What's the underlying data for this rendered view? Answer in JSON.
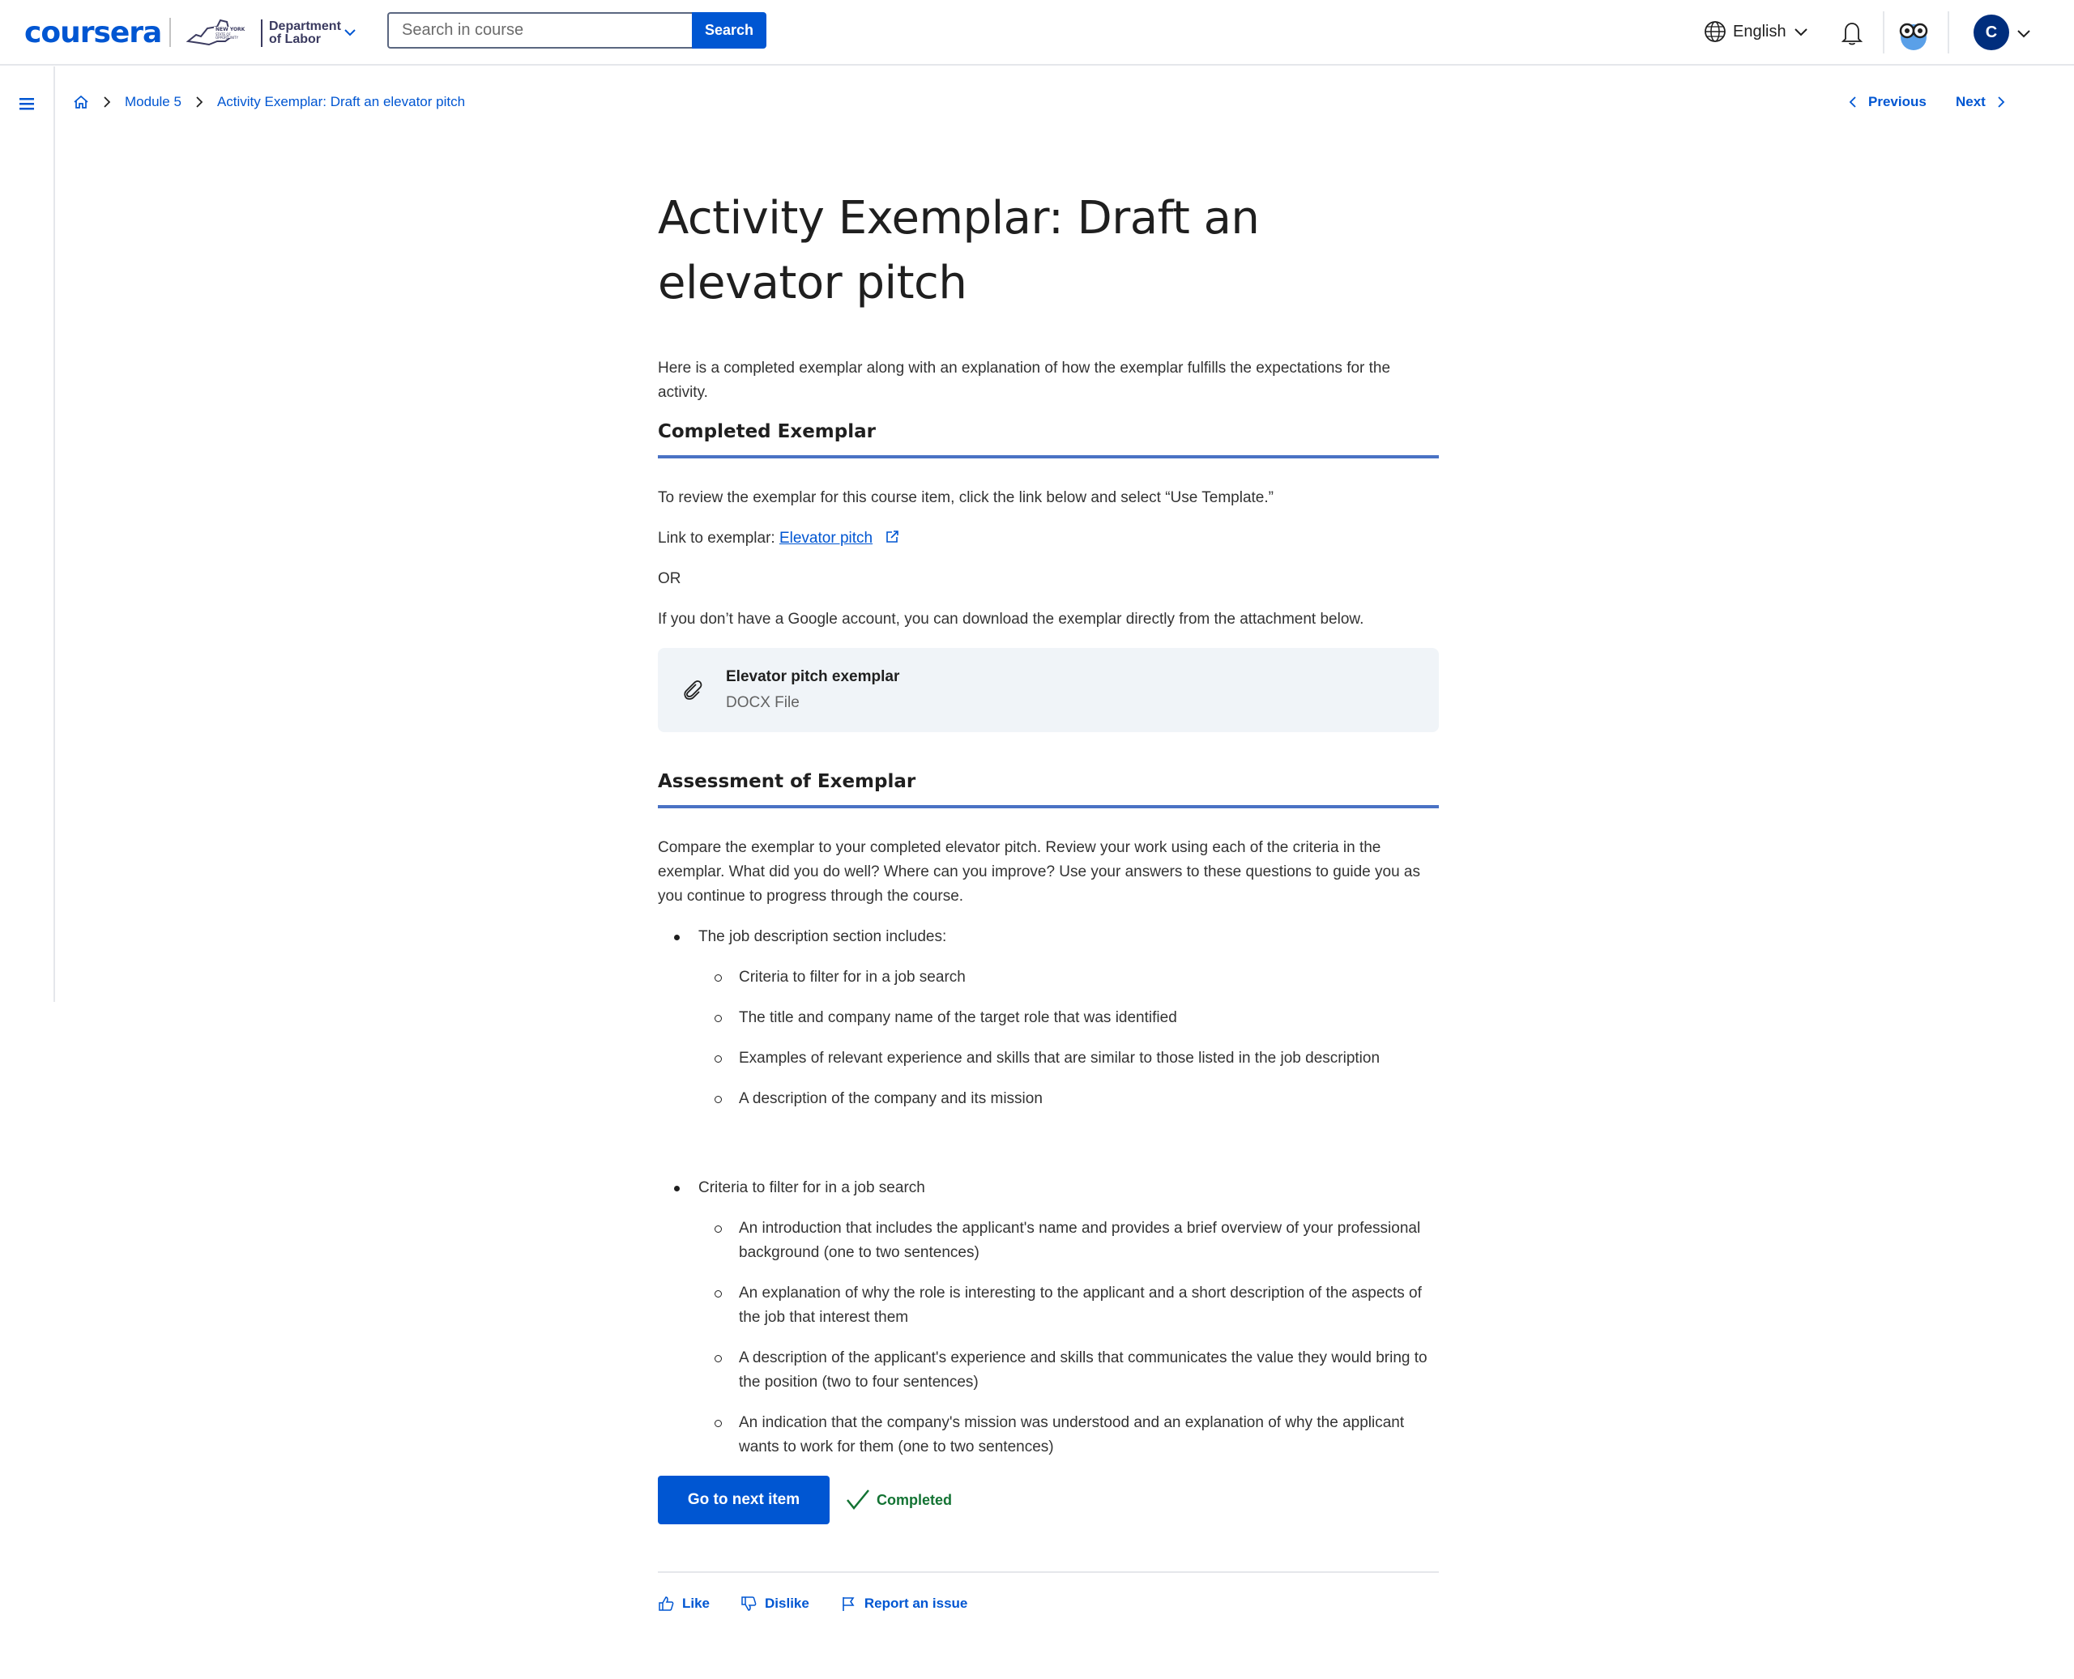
{
  "header": {
    "logo": "coursera",
    "partner": {
      "line1": "Department",
      "line2": "of Labor"
    },
    "search": {
      "placeholder": "Search in course",
      "button_label": "Search"
    },
    "language": "English",
    "avatar_initial": "C"
  },
  "breadcrumb": {
    "items": [
      "Module 5",
      "Activity Exemplar: Draft an elevator pitch"
    ]
  },
  "nav": {
    "previous": "Previous",
    "next": "Next"
  },
  "page": {
    "title": "Activity Exemplar: Draft an elevator pitch",
    "intro": "Here is a completed exemplar along with an explanation of how the exemplar fulfills the expectations for the activity.",
    "section1": {
      "heading": "Completed Exemplar",
      "p1": "To review the exemplar for this course item, click the link below and select “Use Template.”",
      "link_prefix": "Link to exemplar: ",
      "link_text": "Elevator pitch",
      "or": "OR",
      "p2": "If you don’t have a Google account, you can download the exemplar directly from the attachment below.",
      "attachment": {
        "title": "Elevator pitch exemplar",
        "type": "DOCX File"
      }
    },
    "section2": {
      "heading": "Assessment of Exemplar",
      "p1": "Compare the exemplar to your completed elevator pitch. Review your work using each of the criteria in the exemplar. What did you do well? Where can you improve? Use your answers to these questions to guide you as you continue to progress through the course.",
      "lists": [
        {
          "label": "The job description section includes:",
          "items": [
            "Criteria to filter for in a job search",
            "The title and company name of the target role that was identified",
            "Examples of  relevant experience and skills that are similar to those listed in the job description",
            "A description of the company and its mission"
          ]
        },
        {
          "label": "Criteria to filter for in a job search",
          "items": [
            "An introduction that includes the applicant's name and provides a brief overview of your professional background (one to two sentences)",
            "An explanation of why the role is interesting to the applicant and a short description of the aspects of the job that interest them",
            "A description of the applicant's experience and skills that communicates the value they would bring to the position (two to four sentences)",
            "An indication that the company's mission was understood and an explanation of why the applicant wants to work for them (one to two sentences)"
          ]
        }
      ]
    },
    "actions": {
      "next_button": "Go to next item",
      "status": "Completed"
    },
    "feedback": {
      "like": "Like",
      "dislike": "Dislike",
      "report": "Report an issue"
    }
  },
  "colors": {
    "brand": "#0056d2",
    "success": "#137333",
    "section_rule": "#4a72c4"
  }
}
